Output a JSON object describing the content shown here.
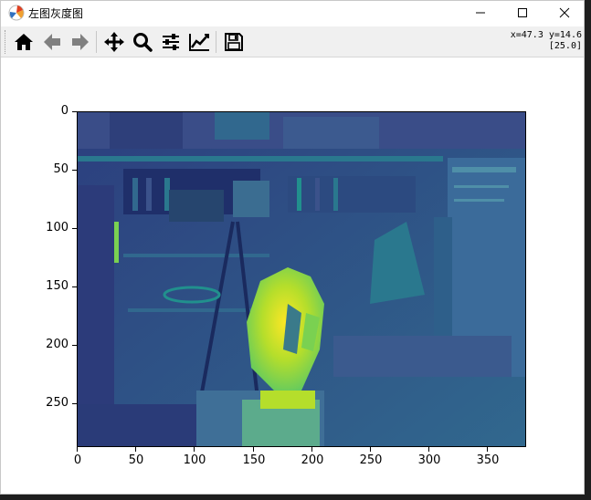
{
  "window": {
    "title": "左图灰度图",
    "app_icon": "matplotlib-icon"
  },
  "toolbar": {
    "buttons": [
      {
        "icon": "home-icon",
        "tooltip": "Home"
      },
      {
        "icon": "back-arrow-icon",
        "tooltip": "Back"
      },
      {
        "icon": "forward-arrow-icon",
        "tooltip": "Forward"
      },
      {
        "icon": "pan-move-icon",
        "tooltip": "Pan"
      },
      {
        "icon": "zoom-magnifier-icon",
        "tooltip": "Zoom"
      },
      {
        "icon": "subplots-sliders-icon",
        "tooltip": "Subplots"
      },
      {
        "icon": "edit-axis-icon",
        "tooltip": "Customize"
      },
      {
        "icon": "save-floppy-icon",
        "tooltip": "Save"
      }
    ],
    "coords_line1": "x=47.3 y=14.6",
    "coords_line2": "[25.0]"
  },
  "plot": {
    "colormap": "viridis",
    "x_ticks": [
      "0",
      "50",
      "100",
      "150",
      "200",
      "250",
      "300",
      "350"
    ],
    "y_ticks": [
      "0",
      "50",
      "100",
      "150",
      "200",
      "250"
    ],
    "xlim": [
      0,
      384
    ],
    "ylim": [
      288,
      0
    ]
  },
  "colors": {
    "viridis_dark": "#440154",
    "viridis_blue": "#3b528b",
    "viridis_teal": "#21908d",
    "viridis_green": "#5dc863",
    "viridis_yellow": "#fde725"
  }
}
